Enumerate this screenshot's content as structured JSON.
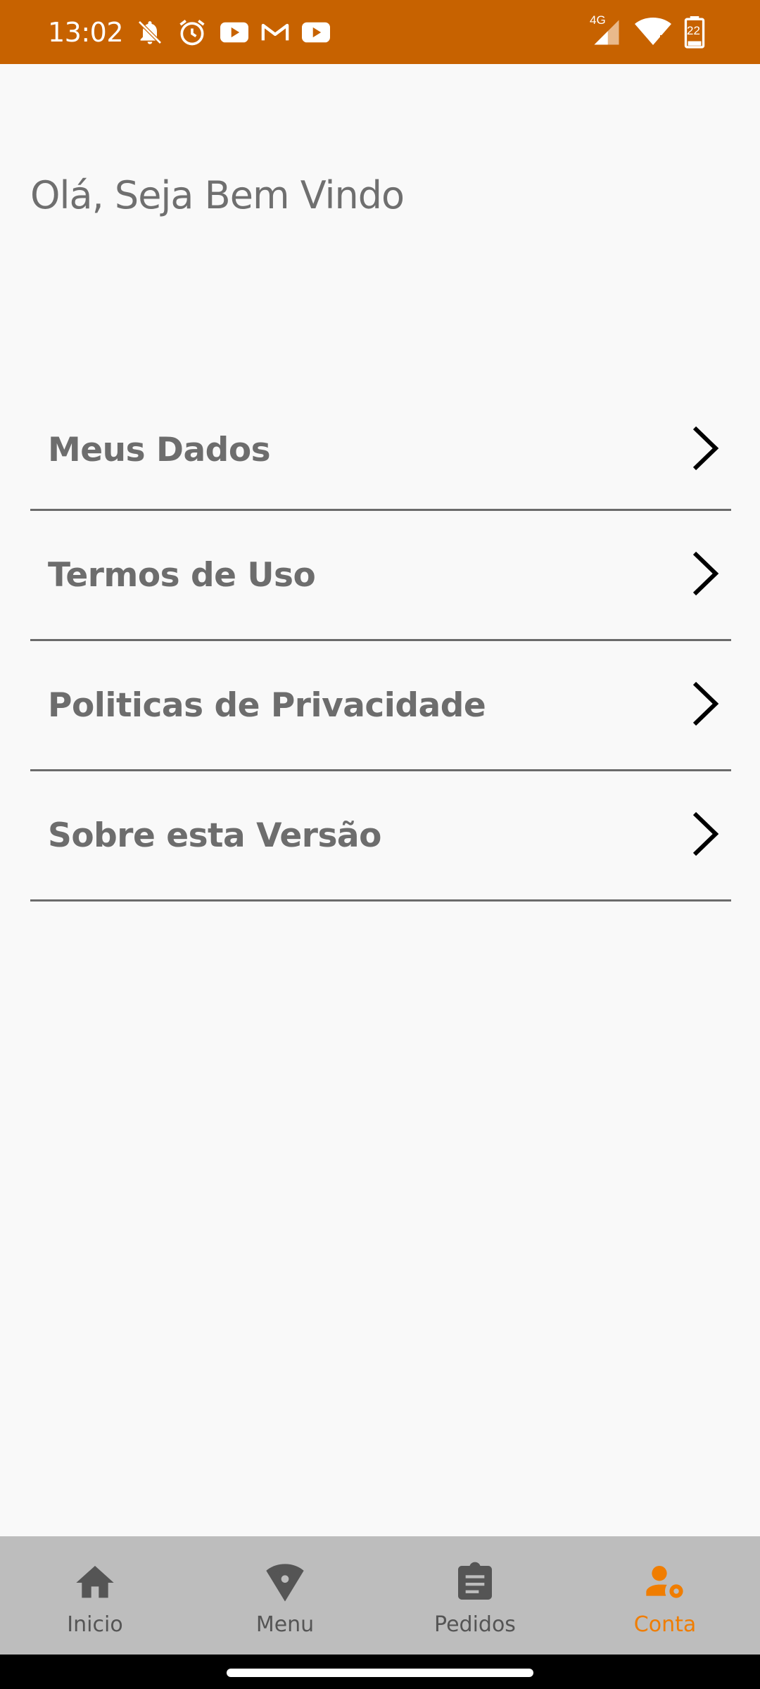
{
  "status_bar": {
    "time": "13:02",
    "network": "4G",
    "battery": "22",
    "background_color": "#c76200",
    "icons_left": [
      "bell-off-icon",
      "alarm-icon",
      "youtube-icon",
      "gmail-icon",
      "youtube-icon"
    ],
    "icons_right": [
      "signal-icon",
      "wifi-icon",
      "battery-icon"
    ]
  },
  "greeting": "Olá, Seja Bem Vindo",
  "menu": {
    "items": [
      {
        "label": "Meus Dados",
        "icon": "chevron-right-icon"
      },
      {
        "label": "Termos de Uso",
        "icon": "chevron-right-icon"
      },
      {
        "label": "Politicas de Privacidade",
        "icon": "chevron-right-icon"
      },
      {
        "label": "Sobre esta Versão",
        "icon": "chevron-right-icon"
      }
    ]
  },
  "bottom_nav": {
    "items": [
      {
        "label": "Inicio",
        "icon": "home-icon",
        "active": false
      },
      {
        "label": "Menu",
        "icon": "pizza-icon",
        "active": false
      },
      {
        "label": "Pedidos",
        "icon": "clipboard-icon",
        "active": false
      },
      {
        "label": "Conta",
        "icon": "user-settings-icon",
        "active": true
      }
    ],
    "active_color": "#f07d00",
    "inactive_color": "#555555"
  }
}
